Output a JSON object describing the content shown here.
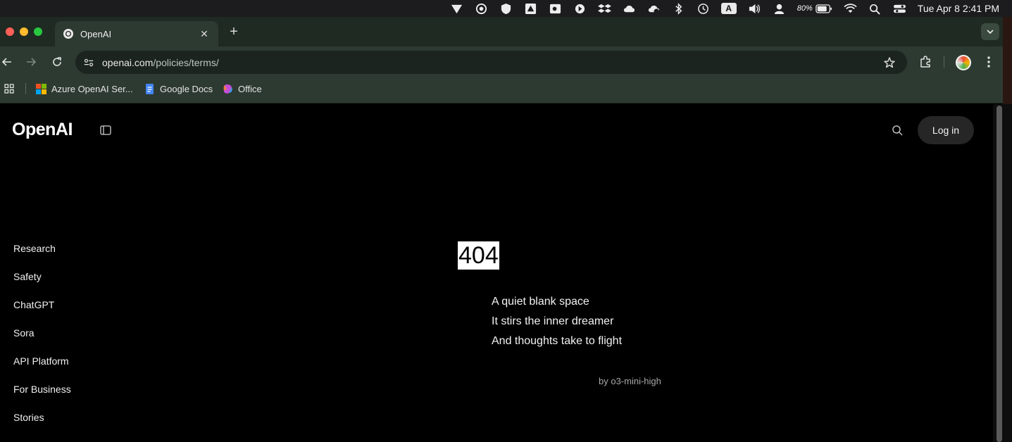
{
  "menubar": {
    "battery_percent": "80%",
    "clock": "Tue Apr 8  2:41 PM",
    "input_letter": "A",
    "icons": [
      "vpn-icon",
      "chatgpt-icon",
      "shield-icon",
      "drive-icon",
      "outlook-icon",
      "cursor-icon",
      "dropbox-icon",
      "cloud-icon",
      "cloud-sync-icon",
      "bluetooth-icon",
      "time-machine-icon",
      "input-source-icon",
      "volume-icon",
      "user-icon",
      "battery-icon",
      "wifi-icon",
      "spotlight-icon",
      "control-center-icon"
    ]
  },
  "browser": {
    "tab_title": "OpenAI",
    "url_host": "openai.com",
    "url_path": "/policies/terms/",
    "bookmarks": [
      {
        "label": "Azure OpenAI Ser...",
        "icon": "microsoft-icon"
      },
      {
        "label": "Google Docs",
        "icon": "google-docs-icon"
      },
      {
        "label": "Office",
        "icon": "office-icon"
      }
    ]
  },
  "page": {
    "logo": "OpenAI",
    "login_label": "Log in",
    "nav": [
      "Research",
      "Safety",
      "ChatGPT",
      "Sora",
      "API Platform",
      "For Business",
      "Stories"
    ],
    "error_code": "404",
    "poem": [
      "A quiet blank space",
      "It stirs the inner dreamer",
      "And thoughts take to flight"
    ],
    "byline": "by o3-mini-high"
  },
  "colors": {
    "page_bg": "#000000",
    "chrome_bg": "#2d3a31",
    "login_bg": "#262626"
  }
}
